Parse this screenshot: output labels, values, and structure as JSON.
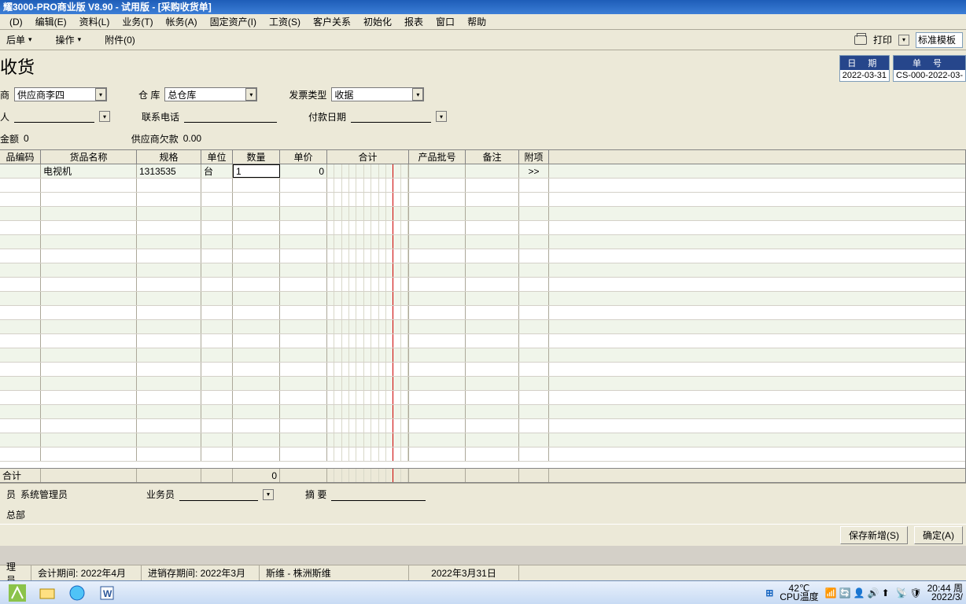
{
  "window": {
    "title": "耀3000-PRO商业版 V8.90 - 试用版 - [采购收货单]"
  },
  "menu": [
    "(D)",
    "编辑(E)",
    "资料(L)",
    "业务(T)",
    "帐务(A)",
    "固定资产(I)",
    "工资(S)",
    "客户关系",
    "初始化",
    "报表",
    "窗口",
    "帮助"
  ],
  "toolbar": {
    "back": "后单",
    "operate": "操作",
    "attach": "附件(0)",
    "print": "打印",
    "template": "标准模板"
  },
  "doc": {
    "title": "收货",
    "date_label": "日   期",
    "date_val": "2022-03-31",
    "no_label": "单   号",
    "no_val": "CS-000-2022-03-",
    "supplier_label": "商",
    "supplier_val": "供应商李四",
    "warehouse_label": "仓    库",
    "warehouse_val": "总仓库",
    "invoice_label": "发票类型",
    "invoice_val": "收据",
    "person_label": "人",
    "phone_label": "联系电话",
    "paydate_label": "付款日期",
    "amount_label": "金额",
    "amount_val": "0",
    "debt_label": "供应商欠款",
    "debt_val": "0.00"
  },
  "grid": {
    "cols": [
      "品编码",
      "货品名称",
      "规格",
      "单位",
      "数量",
      "单价",
      "合计",
      "产品批号",
      "备注",
      "附项"
    ],
    "row": {
      "name": "电视机",
      "spec": "1313535",
      "unit": "台",
      "qty": "1",
      "price": "0",
      "attach": ">>"
    },
    "sum_label": "合计",
    "sum_qty": "0"
  },
  "footer": {
    "user_label": "员",
    "user_val": "系统管理员",
    "sales_label": "业务员",
    "summary_label": "摘   要",
    "dept": "总部",
    "save_new": "保存新增(S)",
    "ok": "确定(A)"
  },
  "status": {
    "admin": "理员",
    "period": "会计期间: 2022年4月",
    "stock_period": "进销存期间: 2022年3月",
    "company": "斯维 - 株洲斯维",
    "date": "2022年3月31日"
  },
  "tray": {
    "temp": "42℃",
    "temp2": "CPU温度",
    "time": "20:44",
    "day": "周",
    "date": "2022/3/"
  }
}
